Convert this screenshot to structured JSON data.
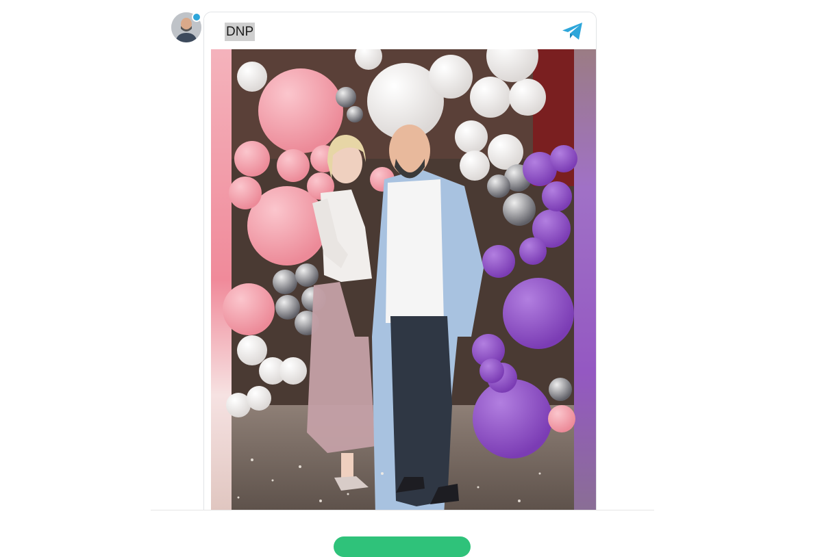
{
  "post": {
    "channel_name": "DNP",
    "avatar_icon": "person-avatar",
    "share_icon": "telegram-plane-icon",
    "photo_desc_icon": "photo"
  },
  "colors": {
    "telegram_blue": "#2ea6da",
    "action_green": "#2fc27a",
    "balloon_pink": "#f29aa8",
    "balloon_purple": "#8b4fc2"
  }
}
